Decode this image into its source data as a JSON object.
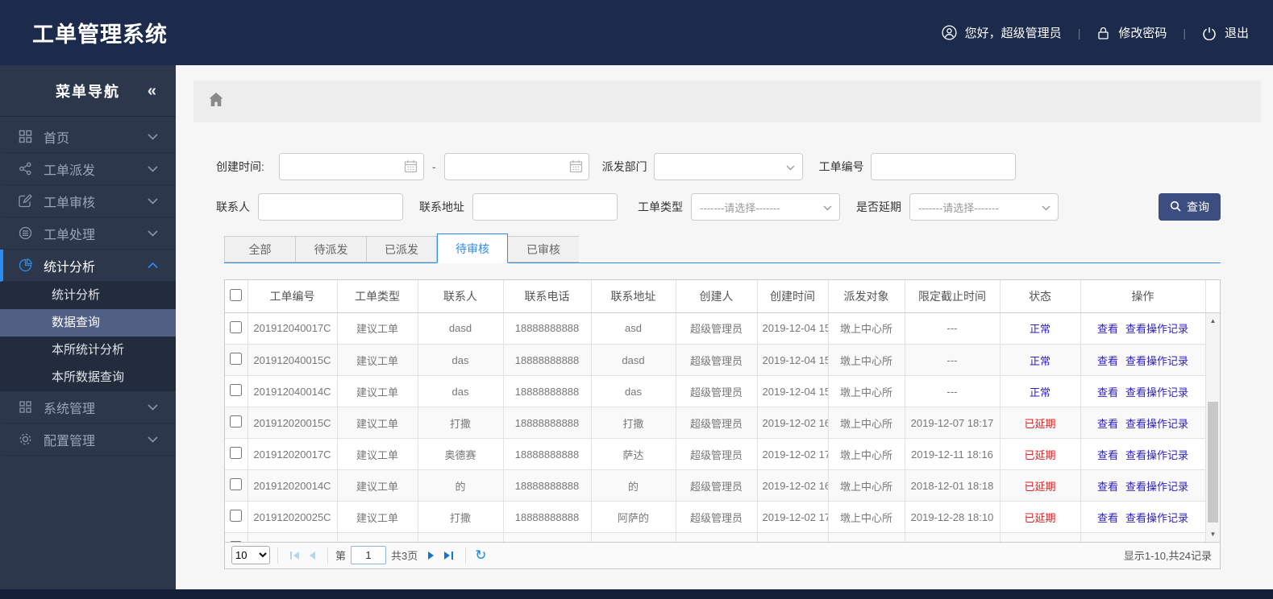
{
  "header": {
    "title": "工单管理系统",
    "greeting": "您好，超级管理员",
    "change_password": "修改密码",
    "logout": "退出"
  },
  "sidebar": {
    "title": "菜单导航",
    "collapse_icon": "«",
    "items": [
      {
        "label": "首页",
        "icon": "grid-icon"
      },
      {
        "label": "工单派发",
        "icon": "share-icon"
      },
      {
        "label": "工单审核",
        "icon": "edit-icon"
      },
      {
        "label": "工单处理",
        "icon": "process-icon"
      },
      {
        "label": "统计分析",
        "icon": "pie-chart-icon",
        "expanded": true,
        "active": true
      },
      {
        "label": "系统管理",
        "icon": "modules-icon"
      },
      {
        "label": "配置管理",
        "icon": "gear-icon"
      }
    ],
    "submenu": [
      {
        "label": "统计分析"
      },
      {
        "label": "数据查询",
        "selected": true
      },
      {
        "label": "本所统计分析"
      },
      {
        "label": "本所数据查询"
      }
    ]
  },
  "filters": {
    "create_time_label": "创建时间:",
    "range_separator": "-",
    "dispatch_dept_label": "派发部门",
    "order_no_label": "工单编号",
    "contact_label": "联系人",
    "address_label": "联系地址",
    "order_type_label": "工单类型",
    "delay_label": "是否延期",
    "select_placeholder": "-------请选择-------",
    "search_button": "查询"
  },
  "tabs": [
    {
      "label": "全部"
    },
    {
      "label": "待派发"
    },
    {
      "label": "已派发"
    },
    {
      "label": "待审核",
      "active": true
    },
    {
      "label": "已审核"
    }
  ],
  "table": {
    "headers": [
      "工单编号",
      "工单类型",
      "联系人",
      "联系电话",
      "联系地址",
      "创建人",
      "创建时间",
      "派发对象",
      "限定截止时间",
      "状态",
      "操作"
    ],
    "action_view": "查看",
    "action_log": "查看操作记录",
    "rows": [
      {
        "order_no": "201912040017C",
        "order_type": "建议工单",
        "contact": "dasd",
        "phone": "18888888888",
        "address": "asd",
        "creator": "超级管理员",
        "create_time": "2019-12-04 15:",
        "dispatch_target": "墩上中心所",
        "deadline": "---",
        "status": "正常",
        "status_type": "normal"
      },
      {
        "order_no": "201912040015C",
        "order_type": "建议工单",
        "contact": "das",
        "phone": "18888888888",
        "address": "dasd",
        "creator": "超级管理员",
        "create_time": "2019-12-04 15:",
        "dispatch_target": "墩上中心所",
        "deadline": "---",
        "status": "正常",
        "status_type": "normal"
      },
      {
        "order_no": "201912040014C",
        "order_type": "建议工单",
        "contact": "das",
        "phone": "18888888888",
        "address": "das",
        "creator": "超级管理员",
        "create_time": "2019-12-04 15:",
        "dispatch_target": "墩上中心所",
        "deadline": "---",
        "status": "正常",
        "status_type": "normal"
      },
      {
        "order_no": "201912020015C",
        "order_type": "建议工单",
        "contact": "打撒",
        "phone": "18888888888",
        "address": "打撒",
        "creator": "超级管理员",
        "create_time": "2019-12-02 16:",
        "dispatch_target": "墩上中心所",
        "deadline": "2019-12-07 18:17",
        "status": "已延期",
        "status_type": "delayed"
      },
      {
        "order_no": "201912020017C",
        "order_type": "建议工单",
        "contact": "奥德赛",
        "phone": "18888888888",
        "address": "萨达",
        "creator": "超级管理员",
        "create_time": "2019-12-02 17:",
        "dispatch_target": "墩上中心所",
        "deadline": "2019-12-11 18:16",
        "status": "已延期",
        "status_type": "delayed"
      },
      {
        "order_no": "201912020014C",
        "order_type": "建议工单",
        "contact": "的",
        "phone": "18888888888",
        "address": "的",
        "creator": "超级管理员",
        "create_time": "2019-12-02 16:",
        "dispatch_target": "墩上中心所",
        "deadline": "2018-12-01 18:18",
        "status": "已延期",
        "status_type": "delayed"
      },
      {
        "order_no": "201912020025C",
        "order_type": "建议工单",
        "contact": "打撒",
        "phone": "18888888888",
        "address": "阿萨的",
        "creator": "超级管理员",
        "create_time": "2019-12-02 17:",
        "dispatch_target": "墩上中心所",
        "deadline": "2019-12-28 18:10",
        "status": "已延期",
        "status_type": "delayed"
      }
    ]
  },
  "pagination": {
    "page_size": "10",
    "page_label_prefix": "第",
    "current_page": "1",
    "total_pages_label": "共3页",
    "summary": "显示1-10,共24记录"
  },
  "colors": {
    "header_bg": "#1c2b4b",
    "sidebar_bg": "#2c374b",
    "accent_blue": "#2d8cf0",
    "status_normal": "#2a1dc8",
    "status_delayed": "#e02020",
    "query_button": "#3c4d80"
  }
}
